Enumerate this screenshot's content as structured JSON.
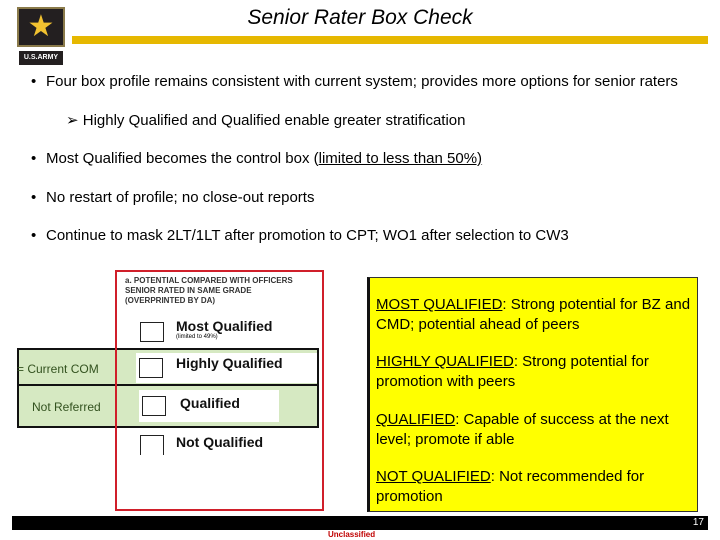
{
  "header": {
    "title": "Senior Rater Box Check",
    "logo_text": "U.S.ARMY"
  },
  "bullets": [
    {
      "text": "Four box profile remains consistent with current system; provides more options for senior raters",
      "sub": "Highly Qualified and Qualified enable greater stratification"
    },
    {
      "text_pre": "Most Qualified becomes the control box (",
      "text_u": "limited to less than 50%)"
    },
    {
      "text": "No restart of profile; no close-out reports"
    },
    {
      "text": "Continue to mask 2LT/1LT after promotion to CPT; WO1 after selection to CW3"
    }
  ],
  "form": {
    "header": "a. POTENTIAL COMPARED WITH OFFICERS SENIOR RATED IN SAME GRADE (OVERPRINTED BY DA)",
    "options": [
      "Most Qualified",
      "Highly Qualified",
      "Qualified",
      "Not Qualified"
    ],
    "most_note": "(limited to 49%)",
    "row_labels": [
      "= Current COM",
      "Not Referred"
    ]
  },
  "definitions": [
    {
      "term": "MOST QUALIFIED",
      "desc": ": Strong potential for BZ and CMD; potential ahead of peers"
    },
    {
      "term": "HIGHLY QUALIFIED",
      "desc": ": Strong potential for promotion with peers"
    },
    {
      "term": "QUALIFIED",
      "desc": ": Capable of success at the next level; promote if able"
    },
    {
      "term": "NOT QUALIFIED",
      "desc": ": Not recommended for promotion"
    }
  ],
  "footer": {
    "page": "17",
    "classification": "Unclassified"
  },
  "colors": {
    "gold": "#e6b800",
    "highlight": "#ffff00",
    "green": "#d6e9c2",
    "red": "#d01f2a"
  }
}
